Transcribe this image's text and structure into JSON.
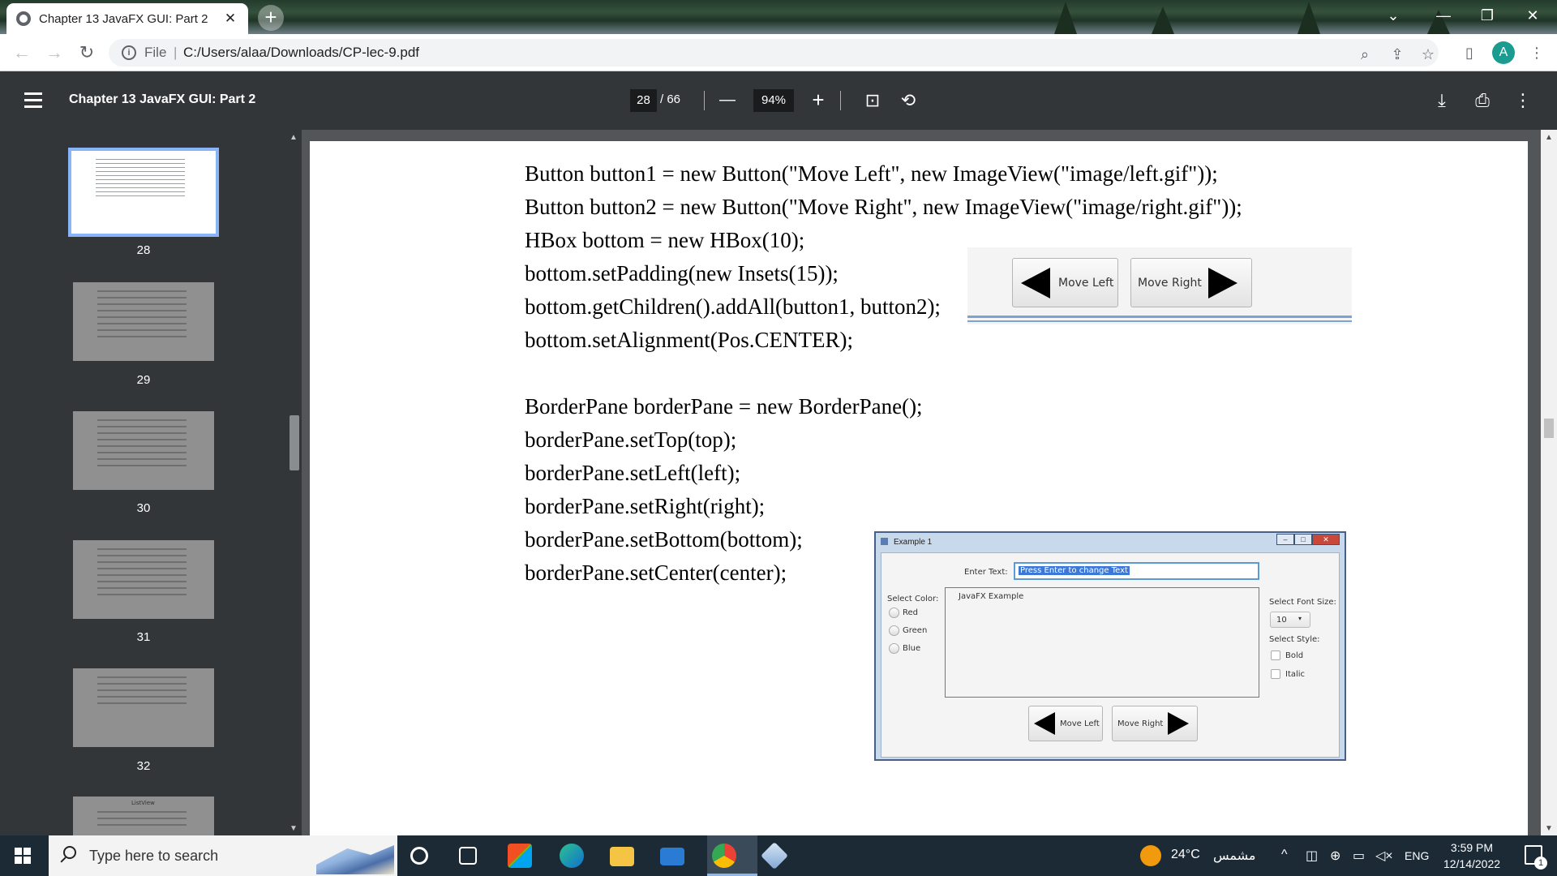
{
  "browser": {
    "tab_title": "Chapter 13 JavaFX GUI: Part 2",
    "tab_close": "✕",
    "new_tab": "+",
    "omnibox_scheme": "File",
    "omnibox_separator": "|",
    "url": "C:/Users/alaa/Downloads/CP-lec-9.pdf",
    "profile_initial": "A",
    "window_controls": {
      "chevron": "⌄",
      "minimize": "—",
      "restore": "❐",
      "close": "✕"
    },
    "nav": {
      "back": "←",
      "forward": "→",
      "reload": "↻"
    },
    "omnibox_icons": {
      "zoom": "⌕",
      "share": "⇪",
      "bookmark": "☆",
      "sidepanel": "▯",
      "menu": "⋮"
    }
  },
  "pdf_toolbar": {
    "title": "Chapter 13 JavaFX GUI: Part 2",
    "current_page": "28",
    "page_total": "/ 66",
    "zoom_out": "—",
    "zoom_level": "94%",
    "zoom_in": "+",
    "icons": {
      "fit": "⊡",
      "rotate": "⟲",
      "download": "⤓",
      "print": "⎙",
      "more": "⋮"
    }
  },
  "sidebar": {
    "thumbnails": [
      {
        "page": "28",
        "active": true
      },
      {
        "page": "29",
        "active": false
      },
      {
        "page": "30",
        "active": false
      },
      {
        "page": "31",
        "active": false
      },
      {
        "page": "32",
        "active": false
      },
      {
        "page": "ListView",
        "active": false
      }
    ]
  },
  "slide": {
    "code_lines_top": [
      "Button button1 = new Button(\"Move Left\", new ImageView(\"image/left.gif\"));",
      "Button button2 = new Button(\"Move Right\", new ImageView(\"image/right.gif\"));",
      "HBox bottom = new HBox(10);",
      "bottom.setPadding(new Insets(15));",
      "bottom.getChildren().addAll(button1, button2);",
      "bottom.setAlignment(Pos.CENTER);"
    ],
    "code_lines_bottom": [
      "BorderPane borderPane = new BorderPane();",
      "borderPane.setTop(top);",
      "borderPane.setLeft(left);",
      "borderPane.setRight(right);",
      "borderPane.setBottom(bottom);",
      "borderPane.setCenter(center);"
    ],
    "hbox_demo": {
      "left_button": "Move Left",
      "right_button": "Move Right"
    },
    "example_window": {
      "title": "Example 1",
      "enter_text_label": "Enter Text:",
      "text_field_value": "Press Enter to change Text",
      "select_color_label": "Select Color:",
      "colors": [
        "Red",
        "Green",
        "Blue"
      ],
      "text_area_value": "JavaFX Example",
      "font_size_label": "Select Font Size:",
      "font_size_value": "10",
      "style_label": "Select Style:",
      "styles": [
        "Bold",
        "Italic"
      ],
      "left_button": "Move Left",
      "right_button": "Move Right"
    }
  },
  "taskbar": {
    "search_placeholder": "Type here to search",
    "weather": "24°C",
    "weather_text": "مشمس",
    "language": "ENG",
    "time": "3:59 PM",
    "date": "12/14/2022",
    "notification_count": "1"
  }
}
